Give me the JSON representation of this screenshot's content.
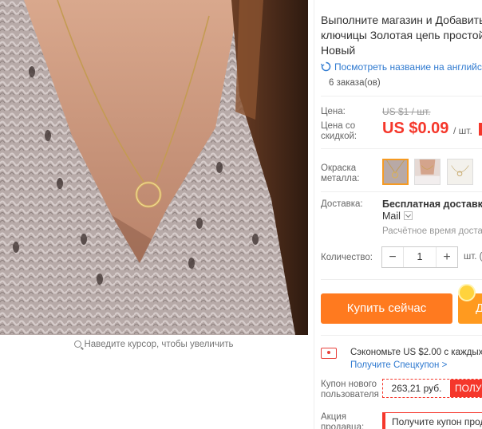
{
  "product": {
    "title_lines": [
      "Выполните магазин и Добавить",
      "ключицы Золотая цепь простой",
      "Новый"
    ],
    "translate_link": "Посмотреть название на английс",
    "orders": "6 заказа(ов)"
  },
  "gallery": {
    "zoom_hint": "Наведите курсор, чтобы увеличить"
  },
  "pricing": {
    "price_label": "Цена:",
    "old_price": "US $1 / шт.",
    "discount_label_line1": "Цена со",
    "discount_label_line2": "скидкой:",
    "price": "US $0.09",
    "unit": "/ шт."
  },
  "options": {
    "color_label_line1": "Окраска",
    "color_label_line2": "металла:",
    "swatches": [
      {
        "name": "gold-circle",
        "selected": true
      },
      {
        "name": "model-photo",
        "selected": false
      },
      {
        "name": "silver-chain",
        "selected": false
      }
    ]
  },
  "shipping": {
    "label": "Доставка:",
    "title": "Бесплатная доставка в",
    "method": "Mail",
    "time": "Расчётное время доставк"
  },
  "quantity": {
    "label": "Количество:",
    "minus": "−",
    "value": "1",
    "plus": "+",
    "unit": "шт. (9"
  },
  "actions": {
    "buy_now": "Купить сейчас",
    "add_to_cart": "Д"
  },
  "promo": {
    "save_text": "Сэкономьте US $2.00 с каждых U",
    "special_link": "Получите Спецкупон >",
    "new_user_label_line1": "Купон нового",
    "new_user_label_line2": "пользователя",
    "new_user_amount": "263,21 руб.",
    "new_user_get": "ПОЛУ",
    "seller_label_line1": "Акция",
    "seller_label_line2": "продавца:",
    "seller_coupon": "Получите купон прода"
  },
  "colors": {
    "accent": "#f5372b",
    "buy_button": "#ff7a1f",
    "link": "#2f7ad0"
  }
}
